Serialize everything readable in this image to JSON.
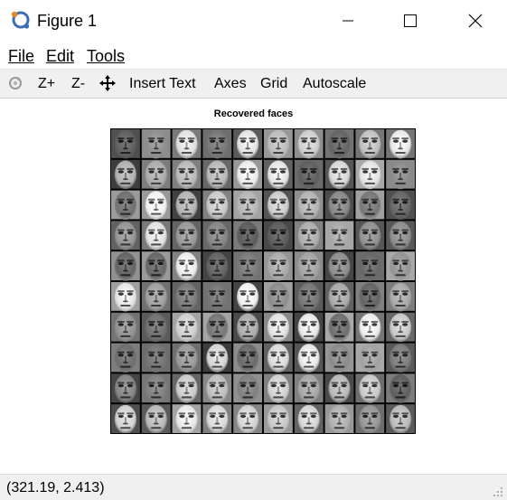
{
  "window": {
    "title": "Figure 1"
  },
  "menu": {
    "items": [
      "File",
      "Edit",
      "Tools"
    ]
  },
  "toolbar": {
    "zoom_in": "Z+",
    "zoom_out": "Z-",
    "insert_text": "Insert Text",
    "axes": "Axes",
    "grid": "Grid",
    "autoscale": "Autoscale"
  },
  "figure": {
    "title": "Recovered faces",
    "grid_rows": 10,
    "grid_cols": 10
  },
  "status": {
    "coordinates": "(321.19, 2.413)"
  },
  "icons": [
    "octave-logo-icon",
    "minimize-icon",
    "maximize-icon",
    "close-icon",
    "rotate-icon",
    "pan-icon",
    "resize-grip-icon"
  ],
  "colors": {
    "toolbar_bg": "#f0f0f0",
    "canvas_bg": "#ffffff",
    "logo_orange": "#e8842a",
    "logo_blue": "#3a6fb5"
  }
}
